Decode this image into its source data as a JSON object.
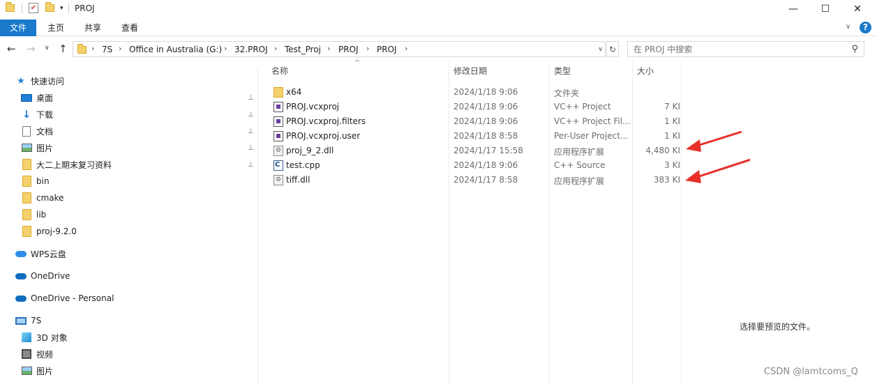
{
  "window": {
    "title": "PROJ",
    "minimize": "—",
    "maximize": "☐",
    "close": "✕"
  },
  "ribbon": {
    "tabs": [
      "文件",
      "主页",
      "共享",
      "查看"
    ],
    "collapse": "∨",
    "help": "?"
  },
  "address": {
    "back": "←",
    "forward": "→",
    "recent": "∨",
    "up": "↑",
    "crumbs": [
      "7S",
      "Office in Australia (G:)",
      "32.PROJ",
      "Test_Proj",
      "PROJ",
      "PROJ"
    ],
    "separator": "›",
    "dropdown": "∨",
    "refresh": "↻"
  },
  "search": {
    "placeholder": "在 PROJ 中搜索"
  },
  "nav": {
    "quick_access": "快速访问",
    "items": [
      {
        "label": "桌面",
        "icon": "desktop-icon",
        "pinned": true
      },
      {
        "label": "下载",
        "icon": "download-icon",
        "pinned": true
      },
      {
        "label": "文档",
        "icon": "document-icon",
        "pinned": true
      },
      {
        "label": "图片",
        "icon": "pictures-icon",
        "pinned": true
      },
      {
        "label": "大二上期末复习资料",
        "icon": "folder-icon",
        "pinned": true
      },
      {
        "label": "bin",
        "icon": "folder-icon",
        "pinned": false
      },
      {
        "label": "cmake",
        "icon": "folder-icon",
        "pinned": false
      },
      {
        "label": "lib",
        "icon": "folder-icon",
        "pinned": false
      },
      {
        "label": "proj-9.2.0",
        "icon": "folder-icon",
        "pinned": false
      }
    ],
    "wps": "WPS云盘",
    "onedrive": "OneDrive",
    "onedrive_personal": "OneDrive - Personal",
    "this_pc": "7S",
    "pc_items": [
      {
        "label": "3D 对象",
        "icon": "3d-objects-icon"
      },
      {
        "label": "视频",
        "icon": "video-icon"
      },
      {
        "label": "图片",
        "icon": "pictures-icon"
      }
    ],
    "pin_glyph": "📌"
  },
  "columns": {
    "name": "名称",
    "date": "修改日期",
    "type": "类型",
    "size": "大小",
    "sort_glyph": "^"
  },
  "files": [
    {
      "name": "x64",
      "date": "2024/1/18 9:06",
      "type": "文件夹",
      "size": "",
      "icon": "folder"
    },
    {
      "name": "PROJ.vcxproj",
      "date": "2024/1/18 9:06",
      "type": "VC++ Project",
      "size": "7 KI",
      "icon": "proj"
    },
    {
      "name": "PROJ.vcxproj.filters",
      "date": "2024/1/18 9:06",
      "type": "VC++ Project Fil...",
      "size": "1 KI",
      "icon": "proj"
    },
    {
      "name": "PROJ.vcxproj.user",
      "date": "2024/1/18 8:58",
      "type": "Per-User Project...",
      "size": "1 KI",
      "icon": "proj"
    },
    {
      "name": "proj_9_2.dll",
      "date": "2024/1/17 15:58",
      "type": "应用程序扩展",
      "size": "4,480 KI",
      "icon": "dll"
    },
    {
      "name": "test.cpp",
      "date": "2024/1/18 9:06",
      "type": "C++ Source",
      "size": "3 KI",
      "icon": "cpp"
    },
    {
      "name": "tiff.dll",
      "date": "2024/1/17 8:58",
      "type": "应用程序扩展",
      "size": "383 KI",
      "icon": "dll"
    }
  ],
  "preview": {
    "message": "选择要预览的文件。"
  },
  "watermark": "CSDN @lamtcoms_Q",
  "colors": {
    "accent": "#1979ca",
    "annotation_arrow": "#e8302a"
  }
}
